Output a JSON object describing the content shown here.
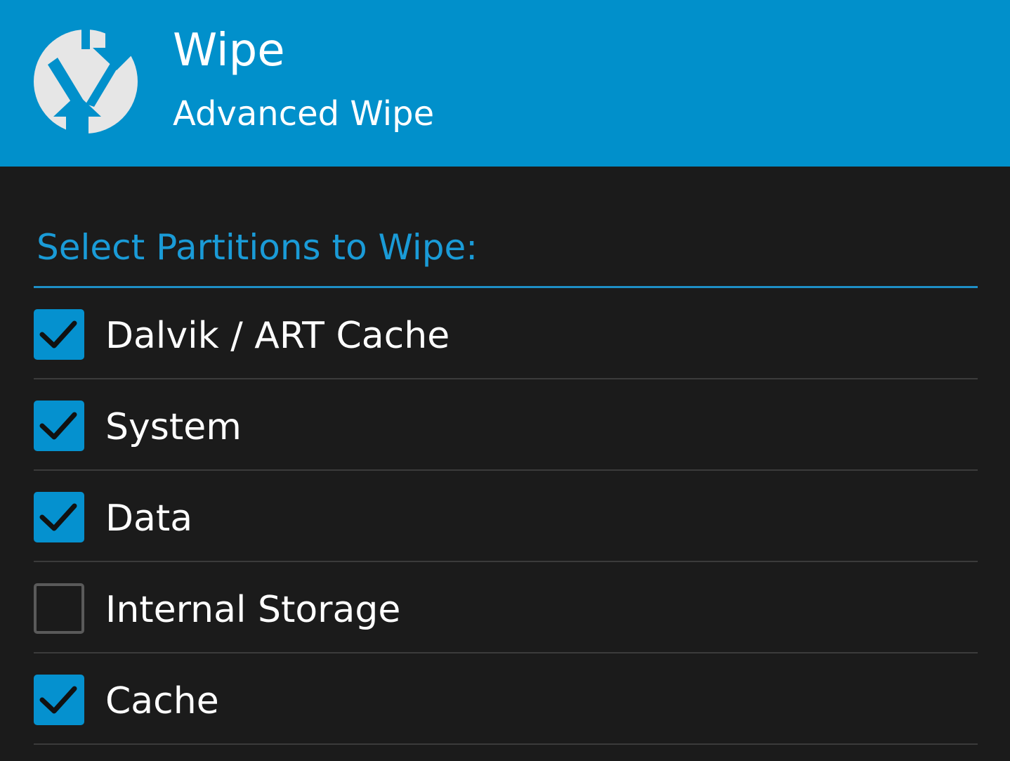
{
  "header": {
    "title": "Wipe",
    "subtitle": "Advanced Wipe",
    "logo_icon": "twrp-logo-icon",
    "background_color": "#0190cb"
  },
  "section": {
    "heading": "Select Partitions to Wipe:",
    "accent_color": "#1a9bd7"
  },
  "partitions": [
    {
      "label": "Dalvik / ART Cache",
      "checked": true
    },
    {
      "label": "System",
      "checked": true
    },
    {
      "label": "Data",
      "checked": true
    },
    {
      "label": "Internal Storage",
      "checked": false
    },
    {
      "label": "Cache",
      "checked": true
    }
  ]
}
